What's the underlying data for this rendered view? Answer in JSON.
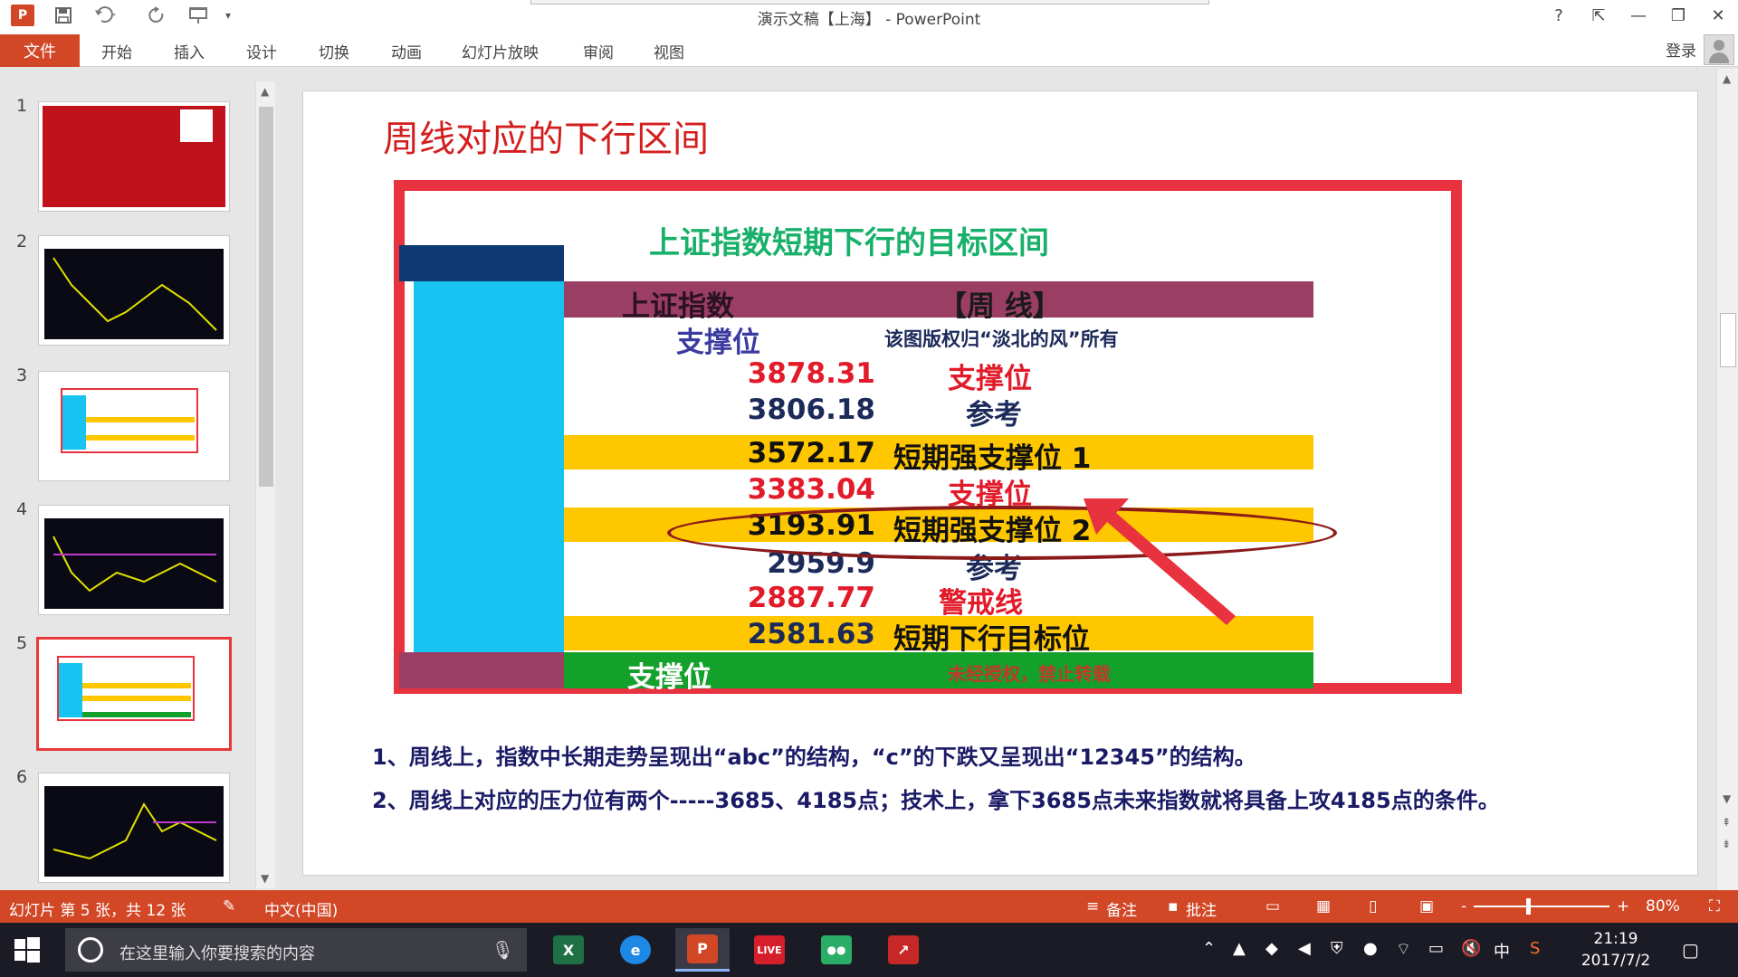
{
  "window": {
    "title": "演示文稿【上海】 - PowerPoint",
    "app_badge": "P",
    "help": "?",
    "ribbon_display": "⇱",
    "minimize": "—",
    "restore": "❐",
    "close": "✕"
  },
  "ribbon": {
    "file": "文件",
    "tabs": [
      "开始",
      "插入",
      "设计",
      "切换",
      "动画",
      "幻灯片放映",
      "审阅",
      "视图"
    ],
    "login": "登录"
  },
  "thumbnails": {
    "numbers": [
      "1",
      "2",
      "3",
      "4",
      "5",
      "6"
    ],
    "selected": 5
  },
  "slide": {
    "title": "周线对应的下行区间",
    "table": {
      "heading": "上证指数短期下行的目标区间",
      "col1_header": "上证指数",
      "col2_header": "【周 线】",
      "row_support_label": "支撑位",
      "copyright": "该图版权归“淡北的风”所有",
      "rows": [
        {
          "value": "3878.31",
          "label": "支撑位",
          "style": "red"
        },
        {
          "value": "3806.18",
          "label": "参考",
          "style": "navy"
        },
        {
          "value": "3572.17",
          "label": "短期强支撑位 1",
          "style": "yellow"
        },
        {
          "value": "3383.04",
          "label": "支撑位",
          "style": "red"
        },
        {
          "value": "3193.91",
          "label": "短期强支撑位 2",
          "style": "yellow"
        },
        {
          "value": "2959.9",
          "label": "参考",
          "style": "navy"
        },
        {
          "value": "2887.77",
          "label": "警戒线",
          "style": "red"
        },
        {
          "value": "2581.63",
          "label": "短期下行目标位",
          "style": "yellow"
        }
      ],
      "footer_label": "支撑位",
      "footer_note": "未经授权，禁止转载"
    },
    "notes": [
      "1、周线上，指数中长期走势呈现出“abc”的结构，“c”的下跌又呈现出“12345”的结构。",
      "2、周线上对应的压力位有两个-----3685、4185点；技术上，拿下3685点未来指数就将具备上攻4185点的条件。"
    ]
  },
  "statusbar": {
    "slide_info": "幻灯片 第 5 张，共 12 张",
    "language": "中文(中国)",
    "notes": "备注",
    "comments": "批注",
    "zoom_minus": "-",
    "zoom_plus": "+",
    "zoom": "80%",
    "zoom_level_fraction": 0.38
  },
  "taskbar": {
    "search_placeholder": "在这里输入你要搜索的内容",
    "apps": [
      {
        "name": "excel",
        "glyph": "X",
        "color": "#1e7145"
      },
      {
        "name": "browser",
        "glyph": "e",
        "color": "#1e88e5"
      },
      {
        "name": "powerpoint",
        "glyph": "P",
        "color": "#d24726"
      },
      {
        "name": "live",
        "glyph": "LIVE",
        "color": "#d61f2b"
      },
      {
        "name": "wechat",
        "glyph": "●●",
        "color": "#2aae67"
      },
      {
        "name": "stock",
        "glyph": "↗",
        "color": "#c62828"
      }
    ],
    "tray_ime": "中",
    "time": "21:19",
    "date": "2017/7/2"
  },
  "colors": {
    "accent": "#d24726",
    "frame_red": "#e8323f",
    "cyan": "#17c3f0",
    "highlight_yellow": "#ffc700",
    "green": "#14a12b",
    "maroon": "#9a3e63"
  }
}
